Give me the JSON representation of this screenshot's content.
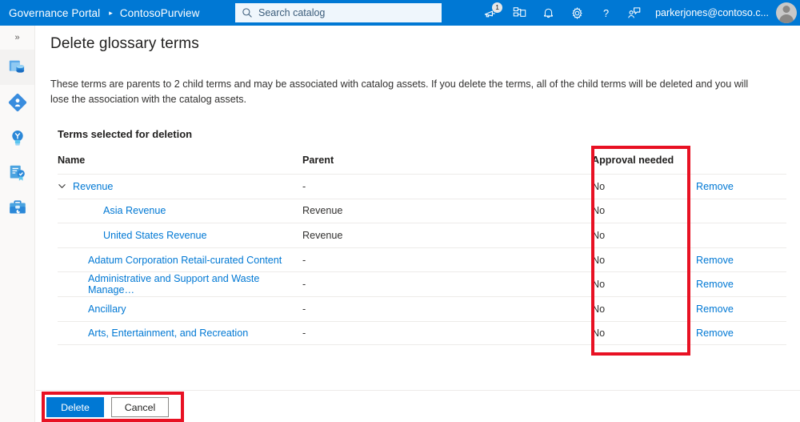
{
  "header": {
    "brand": "Governance Portal",
    "separator": "▸",
    "account": "ContosoPurview",
    "search": {
      "placeholder": "Search catalog",
      "value": ""
    },
    "icons": [
      {
        "name": "feedback-megaphone-icon",
        "badge": "1"
      },
      {
        "name": "data-map-icon",
        "badge": ""
      },
      {
        "name": "notifications-bell-icon",
        "badge": ""
      },
      {
        "name": "settings-gear-icon",
        "badge": ""
      },
      {
        "name": "help-question-icon",
        "badge": ""
      },
      {
        "name": "send-feedback-person-icon",
        "badge": ""
      }
    ],
    "user": "parkerjones@contoso.c..."
  },
  "sidebar": {
    "collapse_glyph": "»",
    "items": [
      {
        "name": "data-catalog-icon",
        "active": true
      },
      {
        "name": "data-map-diamond-icon",
        "active": false
      },
      {
        "name": "data-insights-bulb-icon",
        "active": false
      },
      {
        "name": "data-policy-certificate-icon",
        "active": false
      },
      {
        "name": "management-toolbox-icon",
        "active": false
      }
    ]
  },
  "main": {
    "title": "Delete glossary terms",
    "description": "These terms are parents to 2 child terms and may be associated with catalog assets. If you delete the terms, all of the child terms will be deleted and you will lose the association with the catalog assets.",
    "section_label": "Terms selected for deletion",
    "table": {
      "columns": [
        "Name",
        "Parent",
        "Approval needed",
        ""
      ],
      "rows": [
        {
          "name": "Revenue",
          "parent": "-",
          "approval": "No",
          "action": "Remove",
          "indent": 0,
          "expandable": true
        },
        {
          "name": "Asia Revenue",
          "parent": "Revenue",
          "approval": "No",
          "action": "",
          "indent": 2,
          "expandable": false
        },
        {
          "name": "United States Revenue",
          "parent": "Revenue",
          "approval": "No",
          "action": "",
          "indent": 2,
          "expandable": false
        },
        {
          "name": "Adatum Corporation Retail-curated Content",
          "parent": "-",
          "approval": "No",
          "action": "Remove",
          "indent": 1,
          "expandable": false
        },
        {
          "name": "Administrative and Support and Waste Manage…",
          "parent": "-",
          "approval": "No",
          "action": "Remove",
          "indent": 1,
          "expandable": false
        },
        {
          "name": "Ancillary",
          "parent": "-",
          "approval": "No",
          "action": "Remove",
          "indent": 1,
          "expandable": false
        },
        {
          "name": "Arts, Entertainment, and Recreation",
          "parent": "-",
          "approval": "No",
          "action": "Remove",
          "indent": 1,
          "expandable": false
        }
      ]
    },
    "footer": {
      "delete_label": "Delete",
      "cancel_label": "Cancel"
    }
  },
  "annotations": {
    "color": "#e81123",
    "boxes": [
      {
        "name": "approval-needed-column-highlight"
      },
      {
        "name": "action-buttons-highlight"
      }
    ]
  },
  "colors": {
    "brand_blue": "#0078d4",
    "link_blue": "#0078d4",
    "annotation_red": "#e81123",
    "rail_bg": "#faf9f8",
    "divider": "#edebe9"
  }
}
